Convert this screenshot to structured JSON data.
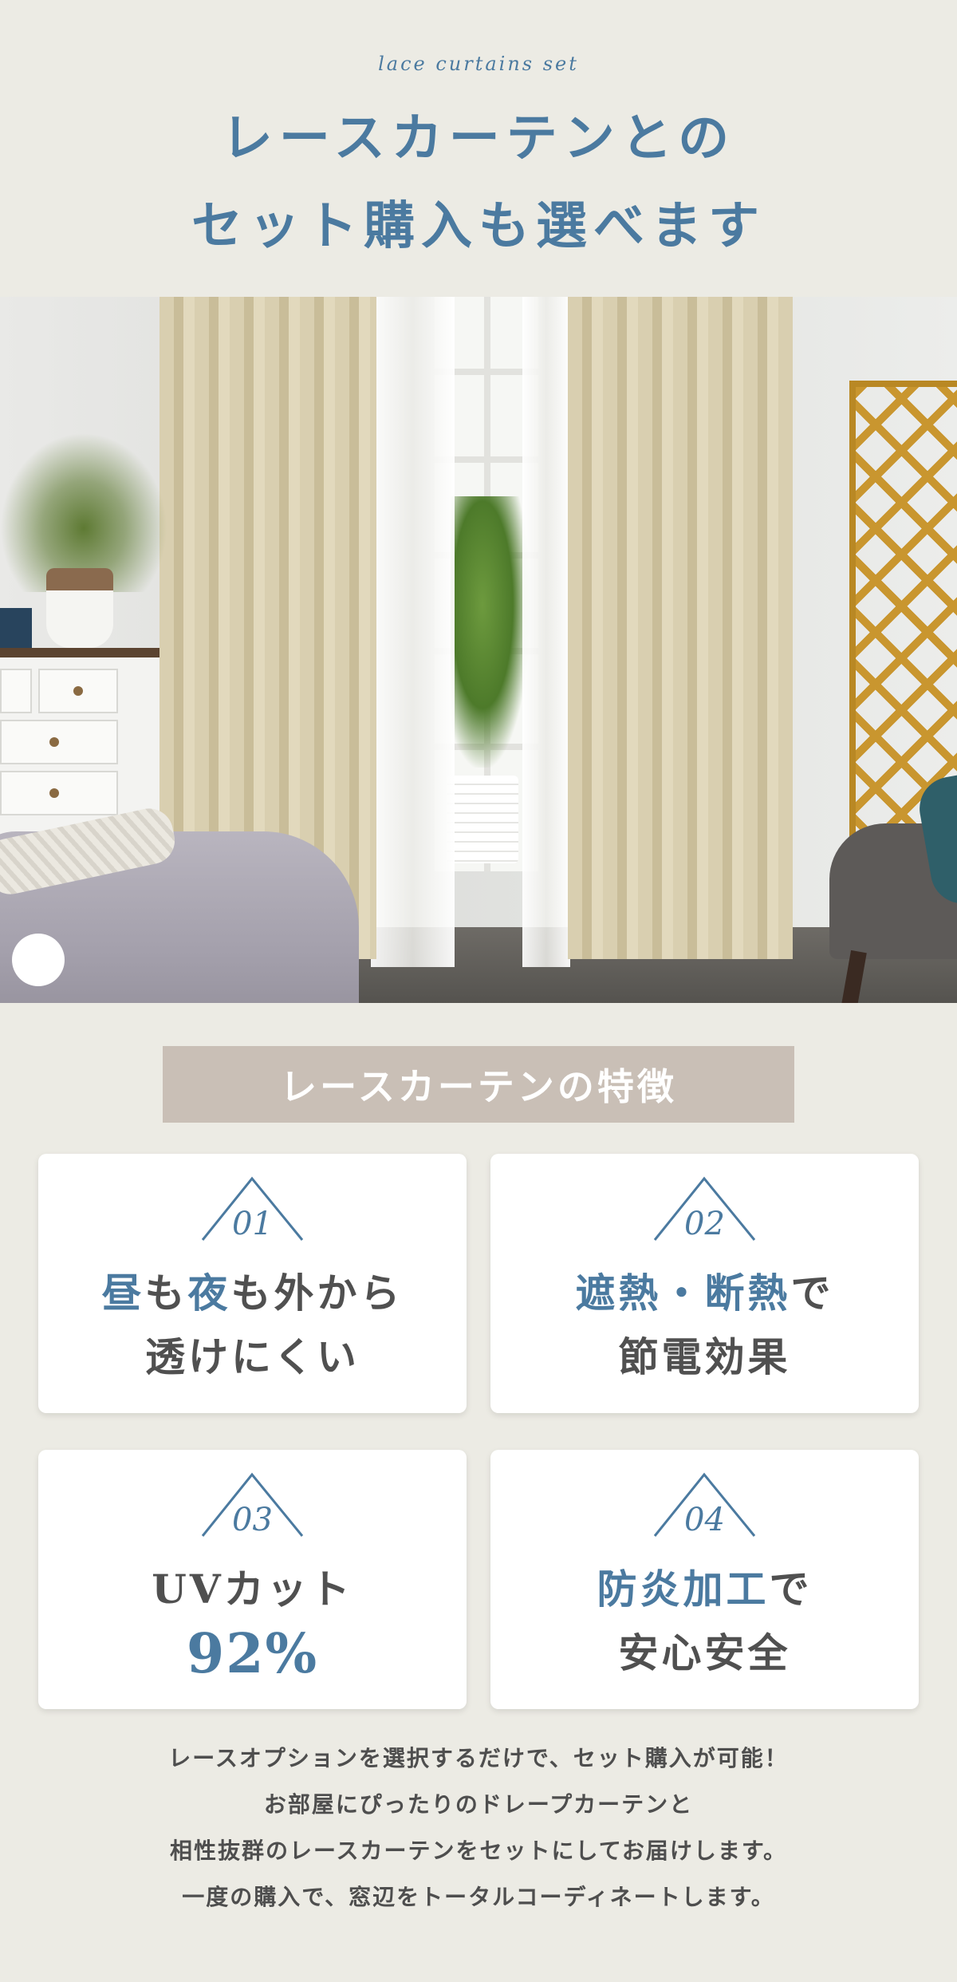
{
  "header": {
    "script": "lace curtains set",
    "title_line1": "レースカーテンとの",
    "title_line2": "セット購入も選べます"
  },
  "colors": {
    "accent": "#4b7aa0",
    "background": "#ecebe4",
    "header_bar": "#c9bfb6",
    "text": "#505050"
  },
  "features": {
    "heading": "レースカーテンの特徴",
    "cards": [
      {
        "num": "01",
        "line1_accent_a": "昼",
        "line1_plain_a": "も",
        "line1_accent_b": "夜",
        "line1_plain_b": "も外から",
        "line2": "透けにくい"
      },
      {
        "num": "02",
        "line1_accent": "遮熱・断熱",
        "line1_plain": "で",
        "line2": "節電効果"
      },
      {
        "num": "03",
        "line1": "UVカット",
        "line2": "92%"
      },
      {
        "num": "04",
        "line1_accent": "防炎加工",
        "line1_plain": "で",
        "line2": "安心安全"
      }
    ]
  },
  "description": [
    "レースオプションを選択するだけで、セット購入が可能！",
    "お部屋にぴったりのドレープカーテンと",
    "相性抜群のレースカーテンをセットにしてお届けします。",
    "一度の購入で、窓辺をトータルコーディネートします。"
  ]
}
